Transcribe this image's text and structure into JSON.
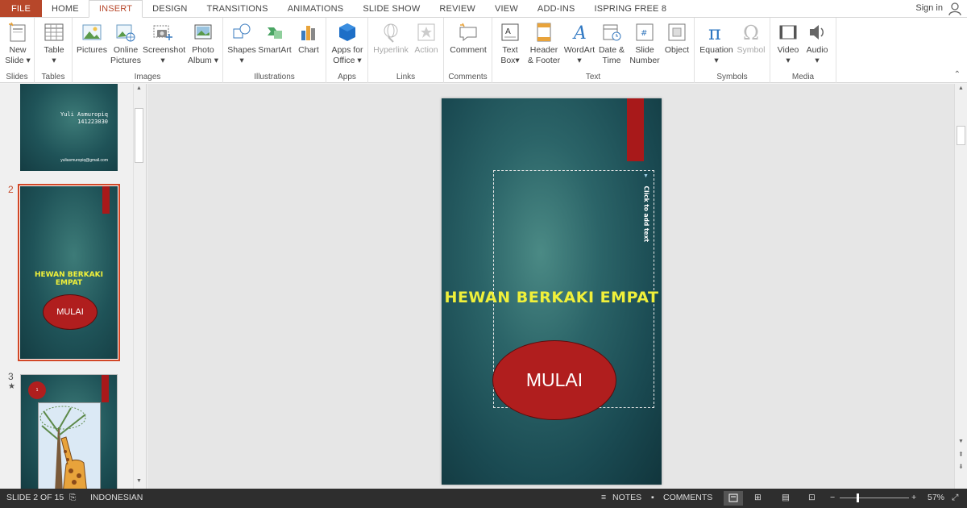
{
  "tabs": [
    "FILE",
    "HOME",
    "INSERT",
    "DESIGN",
    "TRANSITIONS",
    "ANIMATIONS",
    "SLIDE SHOW",
    "REVIEW",
    "VIEW",
    "ADD-INS",
    "ISPRING FREE 8"
  ],
  "active_tab": "INSERT",
  "signin": "Sign in",
  "ribbon": {
    "slides": {
      "label": "Slides",
      "new_slide_1": "New",
      "new_slide_2": "Slide"
    },
    "tables": {
      "label": "Tables",
      "table": "Table"
    },
    "images": {
      "label": "Images",
      "pictures": "Pictures",
      "online_1": "Online",
      "online_2": "Pictures",
      "screenshot": "Screenshot",
      "photo_1": "Photo",
      "photo_2": "Album"
    },
    "illustrations": {
      "label": "Illustrations",
      "shapes": "Shapes",
      "smartart": "SmartArt",
      "chart": "Chart"
    },
    "apps": {
      "label": "Apps",
      "apps_1": "Apps for",
      "apps_2": "Office"
    },
    "links": {
      "label": "Links",
      "hyperlink": "Hyperlink",
      "action": "Action"
    },
    "comments": {
      "label": "Comments",
      "comment": "Comment"
    },
    "text": {
      "label": "Text",
      "textbox_1": "Text",
      "textbox_2": "Box",
      "header_1": "Header",
      "header_2": "& Footer",
      "wordart": "WordArt",
      "date_1": "Date &",
      "date_2": "Time",
      "slidenum_1": "Slide",
      "slidenum_2": "Number",
      "object": "Object"
    },
    "symbols": {
      "label": "Symbols",
      "equation": "Equation",
      "symbol": "Symbol"
    },
    "media": {
      "label": "Media",
      "video": "Video",
      "audio": "Audio"
    }
  },
  "thumbnails": {
    "slide1": {
      "name": "Yuli Asmuropiq",
      "id": "141223030",
      "email": "yuliasmuropiq@gmail.com"
    },
    "slide2": {
      "number": "2",
      "title": "HEWAN BERKAKI EMPAT",
      "button": "MULAI"
    },
    "slide3": {
      "number": "3",
      "star": "★",
      "badge": "1"
    }
  },
  "slide": {
    "title": "HEWAN BERKAKI EMPAT",
    "button": "MULAI",
    "placeholder": "Click to add text"
  },
  "status": {
    "slide_info": "SLIDE 2 OF 15",
    "language": "INDONESIAN",
    "notes": "NOTES",
    "comments": "COMMENTS",
    "zoom": "57%"
  },
  "colors": {
    "accent": "#b7472a",
    "title_yellow": "#f0f03a",
    "oval_red": "#b01e1e",
    "ribbon_red": "#a8191a"
  }
}
